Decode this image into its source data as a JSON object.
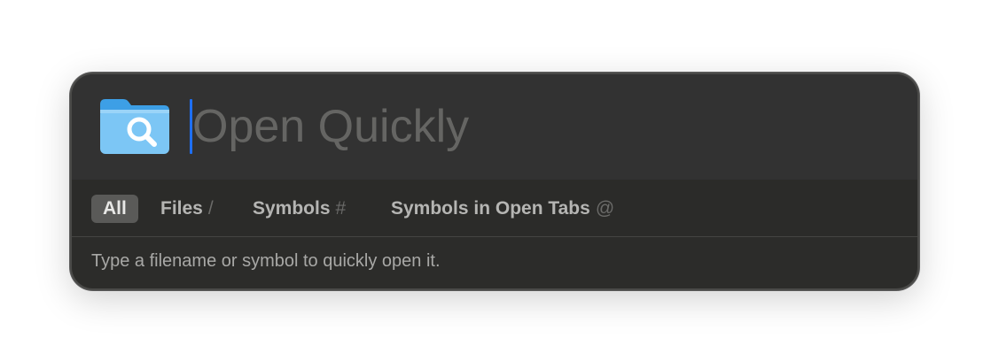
{
  "search": {
    "value": "",
    "placeholder": "Open Quickly"
  },
  "app_icon": "folder-magnifier-icon",
  "scopes": [
    {
      "label": "All",
      "shortcut": "",
      "active": true
    },
    {
      "label": "Files",
      "shortcut": "/",
      "active": false
    },
    {
      "label": "Symbols",
      "shortcut": "#",
      "active": false
    },
    {
      "label": "Symbols in Open Tabs",
      "shortcut": "@",
      "active": false
    }
  ],
  "hint_text": "Type a filename or symbol to quickly open it.",
  "colors": {
    "caret": "#1e6ff5",
    "panel_background": "#2c2c2a",
    "folder_light": "#7cc6f5",
    "folder_dark": "#3d9fe6"
  }
}
